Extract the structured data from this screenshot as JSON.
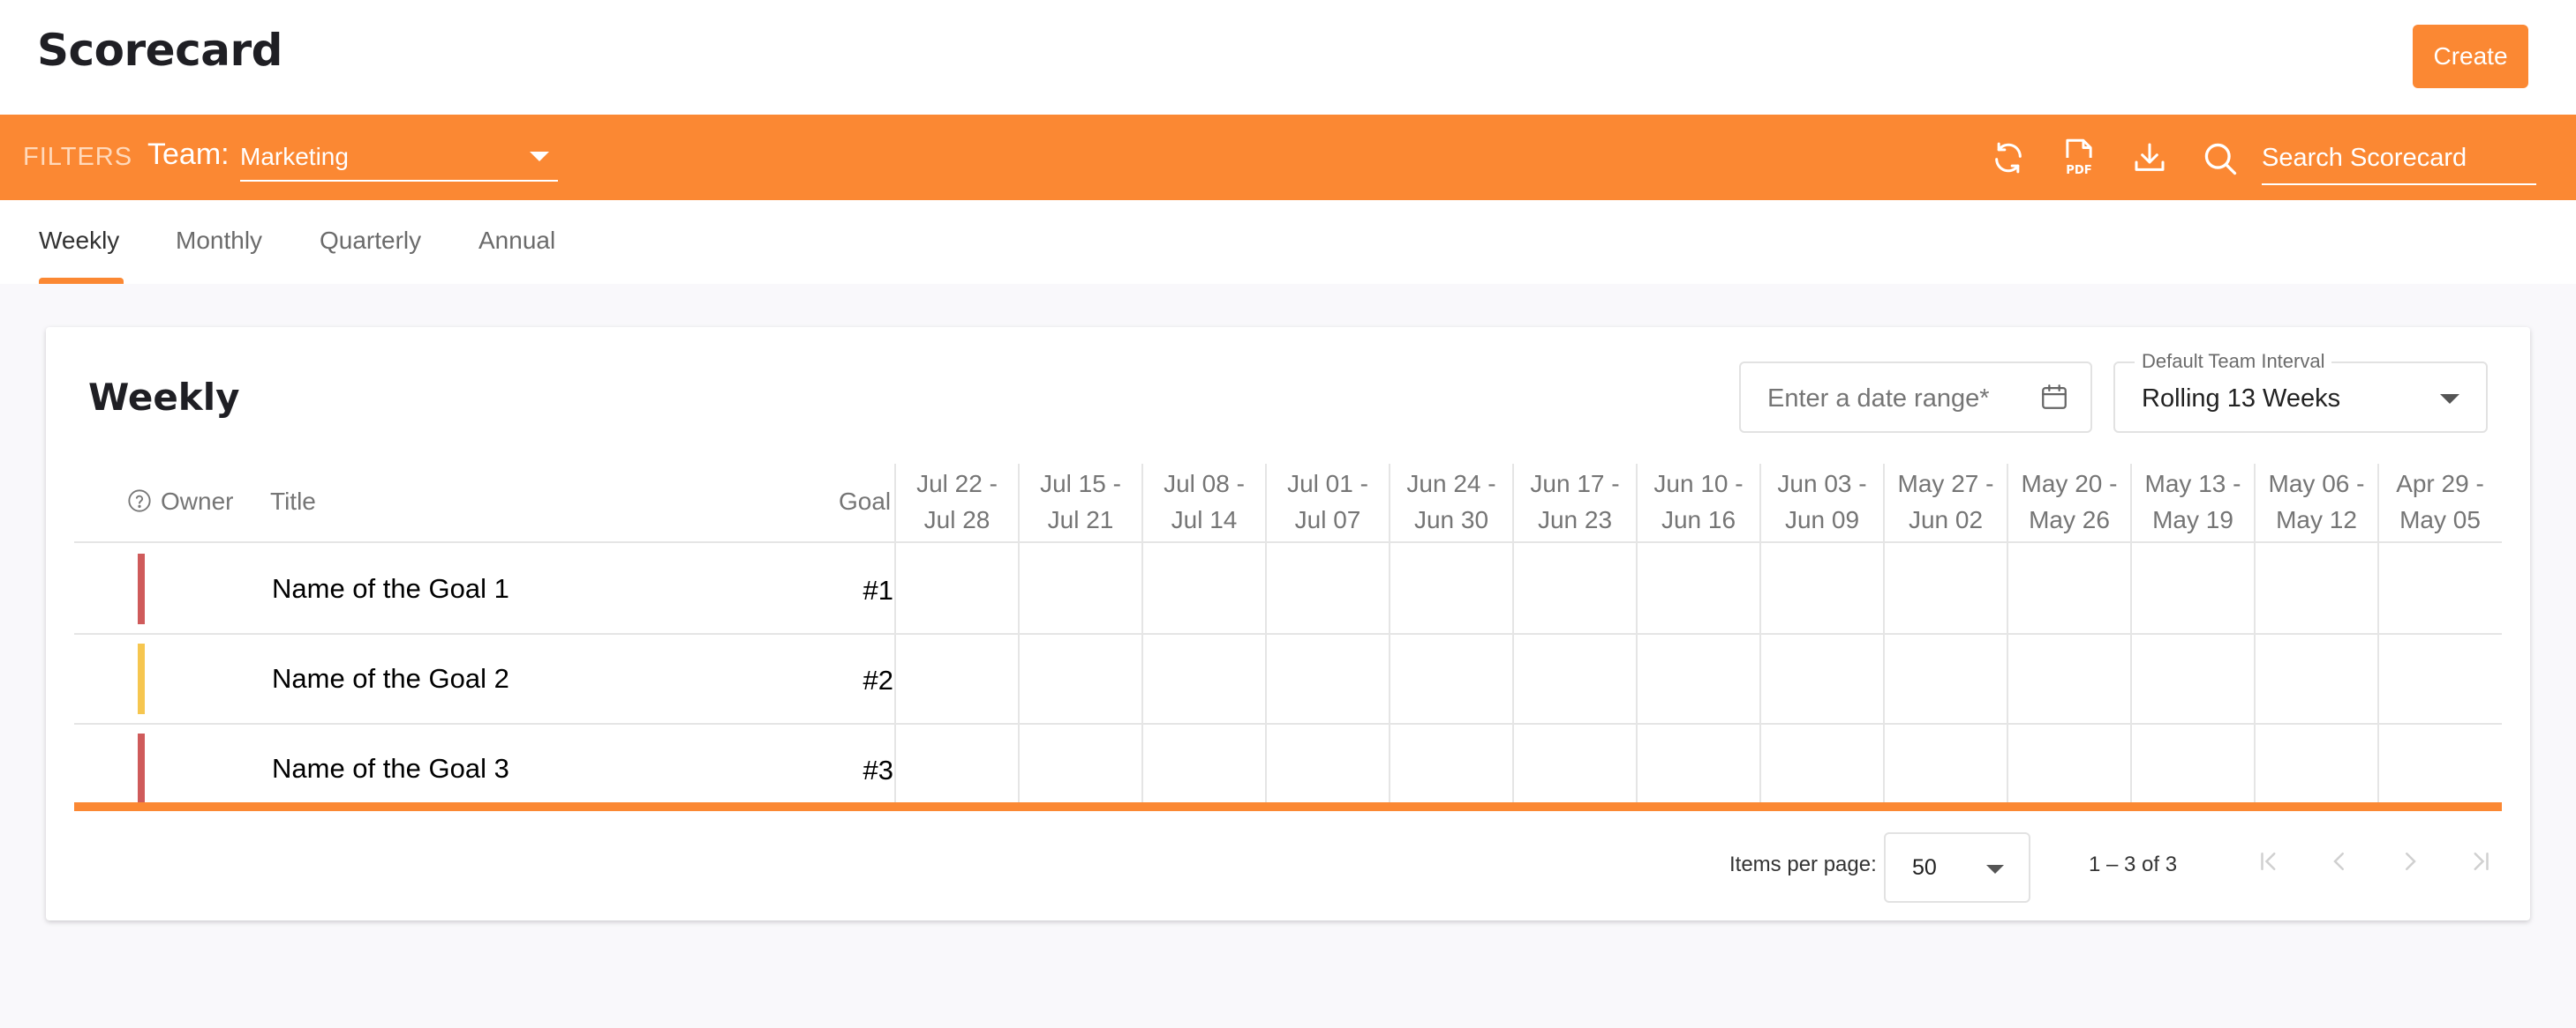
{
  "header": {
    "title": "Scorecard",
    "create_label": "Create"
  },
  "filters": {
    "label": "FILTERS",
    "team_label": "Team:",
    "team_value": "Marketing",
    "search_placeholder": "Search Scorecard",
    "icons": [
      "refresh-icon",
      "pdf-icon",
      "download-icon",
      "search-icon"
    ]
  },
  "tabs": [
    {
      "label": "Weekly",
      "active": true
    },
    {
      "label": "Monthly",
      "active": false
    },
    {
      "label": "Quarterly",
      "active": false
    },
    {
      "label": "Annual",
      "active": false
    }
  ],
  "card": {
    "title": "Weekly",
    "date_range_placeholder": "Enter a date range*",
    "interval_label": "Default Team Interval",
    "interval_value": "Rolling 13 Weeks"
  },
  "table": {
    "columns": {
      "owner": "Owner",
      "title": "Title",
      "goal": "Goal"
    },
    "weeks": [
      [
        "Jul 22 -",
        "Jul 28"
      ],
      [
        "Jul 15 -",
        "Jul 21"
      ],
      [
        "Jul 08 -",
        "Jul 14"
      ],
      [
        "Jul 01 -",
        "Jul 07"
      ],
      [
        "Jun 24 -",
        "Jun 30"
      ],
      [
        "Jun 17 -",
        "Jun 23"
      ],
      [
        "Jun 10 -",
        "Jun 16"
      ],
      [
        "Jun 03 -",
        "Jun 09"
      ],
      [
        "May 27 -",
        "Jun 02"
      ],
      [
        "May 20 -",
        "May 26"
      ],
      [
        "May 13 -",
        "May 19"
      ],
      [
        "May 06 -",
        "May 12"
      ],
      [
        "Apr 29 -",
        "May 05"
      ]
    ],
    "rows": [
      {
        "title": "Name of the Goal 1",
        "goal": "#1",
        "status_color": "#cf5b5b"
      },
      {
        "title": "Name of the Goal 2",
        "goal": "#2",
        "status_color": "#f6c64f"
      },
      {
        "title": "Name of the Goal 3",
        "goal": "#3",
        "status_color": "#cf5b5b"
      }
    ]
  },
  "pagination": {
    "items_per_page_label": "Items per page:",
    "items_per_page": "50",
    "range_label": "1 – 3 of 3"
  },
  "colors": {
    "accent": "#fb8833"
  }
}
